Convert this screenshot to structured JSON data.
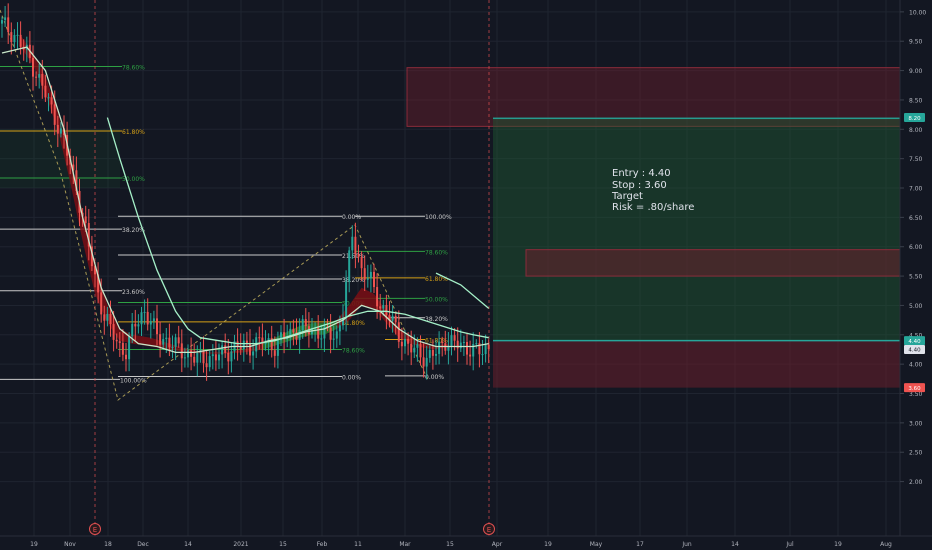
{
  "chart_data": {
    "type": "candlestick",
    "ylim": [
      1.55,
      10.1
    ],
    "x_ticks": [
      "19",
      "Nov",
      "18",
      "Dec",
      "14",
      "2021",
      "15",
      "Feb",
      "11",
      "Mar",
      "15",
      "Apr",
      "19",
      "May",
      "17",
      "Jun",
      "14",
      "Jul",
      "19",
      "Aug"
    ],
    "y_ticks": [
      "10.00",
      "9.50",
      "9.00",
      "8.50",
      "8.00",
      "7.50",
      "7.00",
      "6.50",
      "6.00",
      "5.50",
      "5.00",
      "4.50",
      "4.00",
      "3.50",
      "3.00",
      "2.50",
      "2.00"
    ],
    "y_tick_values": [
      10,
      9.5,
      9,
      8.5,
      8,
      7.5,
      7,
      6.5,
      6,
      5.5,
      5,
      4.5,
      4,
      3.5,
      3,
      2.5,
      2
    ],
    "price_path": [
      [
        0,
        9.8
      ],
      [
        4,
        9.6
      ],
      [
        8,
        9.3
      ],
      [
        14,
        8.6
      ],
      [
        20,
        7.8
      ],
      [
        24,
        7.0
      ],
      [
        28,
        6.0
      ],
      [
        31,
        5.2
      ],
      [
        33,
        4.8
      ],
      [
        36,
        4.5
      ],
      [
        38,
        4.3
      ],
      [
        40,
        4.2
      ],
      [
        43,
        4.7
      ],
      [
        46,
        4.9
      ],
      [
        50,
        4.5
      ],
      [
        56,
        4.3
      ],
      [
        62,
        4.1
      ],
      [
        68,
        4.1
      ],
      [
        72,
        4.2
      ],
      [
        76,
        4.3
      ],
      [
        80,
        4.3
      ],
      [
        84,
        4.4
      ],
      [
        88,
        4.3
      ],
      [
        92,
        4.5
      ],
      [
        96,
        4.6
      ],
      [
        100,
        4.6
      ],
      [
        104,
        4.5
      ],
      [
        108,
        4.5
      ],
      [
        110,
        4.9
      ],
      [
        113,
        6.2
      ],
      [
        116,
        5.6
      ],
      [
        119,
        5.4
      ],
      [
        122,
        5.0
      ],
      [
        125,
        4.8
      ],
      [
        128,
        4.5
      ],
      [
        131,
        4.3
      ],
      [
        134,
        4.2
      ],
      [
        137,
        4.1
      ],
      [
        140,
        4.2
      ],
      [
        143,
        4.4
      ],
      [
        146,
        4.35
      ],
      [
        149,
        4.3
      ],
      [
        152,
        4.25
      ],
      [
        155,
        4.2
      ],
      [
        157,
        4.3
      ]
    ],
    "moving_average": [
      [
        0,
        9.3
      ],
      [
        8,
        9.4
      ],
      [
        14,
        9.0
      ],
      [
        20,
        8.0
      ],
      [
        26,
        6.5
      ],
      [
        32,
        5.3
      ],
      [
        38,
        4.6
      ],
      [
        44,
        4.35
      ],
      [
        50,
        4.3
      ],
      [
        56,
        4.2
      ],
      [
        62,
        4.2
      ],
      [
        68,
        4.25
      ],
      [
        74,
        4.3
      ],
      [
        80,
        4.3
      ],
      [
        86,
        4.4
      ],
      [
        92,
        4.45
      ],
      [
        98,
        4.55
      ],
      [
        104,
        4.6
      ],
      [
        110,
        4.75
      ],
      [
        116,
        5.0
      ],
      [
        122,
        4.9
      ],
      [
        128,
        4.6
      ],
      [
        134,
        4.4
      ],
      [
        140,
        4.3
      ],
      [
        146,
        4.3
      ],
      [
        152,
        4.3
      ],
      [
        157,
        4.35
      ]
    ],
    "ribbon_upper": [
      [
        6,
        9.6
      ],
      [
        10,
        9.3
      ],
      [
        14,
        8.9
      ],
      [
        18,
        8.3
      ],
      [
        22,
        7.5
      ],
      [
        26,
        6.6
      ],
      [
        30,
        5.7
      ],
      [
        34,
        5.0
      ],
      [
        38,
        4.6
      ],
      [
        42,
        4.5
      ],
      [
        48,
        4.45
      ],
      [
        54,
        4.35
      ],
      [
        60,
        4.25
      ],
      [
        66,
        4.2
      ],
      [
        72,
        4.2
      ],
      [
        78,
        4.25
      ],
      [
        84,
        4.35
      ],
      [
        90,
        4.5
      ],
      [
        96,
        4.65
      ],
      [
        100,
        4.7
      ],
      [
        104,
        4.7
      ],
      [
        108,
        4.75
      ],
      [
        112,
        5.0
      ],
      [
        116,
        5.3
      ],
      [
        120,
        5.2
      ],
      [
        124,
        4.9
      ],
      [
        128,
        4.6
      ],
      [
        132,
        4.45
      ],
      [
        136,
        4.35
      ],
      [
        140,
        4.3
      ],
      [
        144,
        4.35
      ]
    ],
    "ribbon_lower": [
      [
        6,
        9.4
      ],
      [
        10,
        9.1
      ],
      [
        14,
        8.6
      ],
      [
        18,
        8.0
      ],
      [
        22,
        7.1
      ],
      [
        26,
        6.1
      ],
      [
        30,
        5.2
      ],
      [
        34,
        4.7
      ],
      [
        38,
        4.4
      ],
      [
        42,
        4.35
      ],
      [
        48,
        4.3
      ],
      [
        54,
        4.25
      ],
      [
        60,
        4.2
      ],
      [
        66,
        4.18
      ],
      [
        72,
        4.18
      ],
      [
        78,
        4.2
      ],
      [
        84,
        4.25
      ],
      [
        90,
        4.35
      ],
      [
        96,
        4.45
      ],
      [
        100,
        4.5
      ],
      [
        104,
        4.5
      ],
      [
        108,
        4.6
      ],
      [
        112,
        4.75
      ],
      [
        116,
        5.0
      ],
      [
        120,
        4.95
      ],
      [
        124,
        4.7
      ],
      [
        128,
        4.45
      ],
      [
        132,
        4.35
      ],
      [
        136,
        4.28
      ],
      [
        140,
        4.25
      ],
      [
        144,
        4.3
      ]
    ],
    "slow_ma": [
      [
        34,
        8.2
      ],
      [
        38,
        7.5
      ],
      [
        44,
        6.5
      ],
      [
        50,
        5.6
      ],
      [
        56,
        4.9
      ],
      [
        60,
        4.6
      ],
      [
        64,
        4.45
      ],
      [
        70,
        4.4
      ],
      [
        76,
        4.35
      ],
      [
        82,
        4.35
      ],
      [
        88,
        4.4
      ],
      [
        94,
        4.5
      ],
      [
        100,
        4.6
      ],
      [
        106,
        4.7
      ],
      [
        112,
        4.82
      ],
      [
        118,
        4.9
      ],
      [
        124,
        4.9
      ],
      [
        130,
        4.85
      ],
      [
        136,
        4.75
      ],
      [
        142,
        4.65
      ],
      [
        148,
        4.55
      ],
      [
        152,
        4.5
      ],
      [
        157,
        4.45
      ]
    ],
    "fib_levels": [
      {
        "label": "78.60%",
        "value": 9.07
      },
      {
        "label": "61.80%",
        "value": 7.97
      },
      {
        "label": "50.00%",
        "value": 7.17
      },
      {
        "label": "38.20%",
        "value": 6.3
      },
      {
        "label": "23.60%",
        "value": 5.25
      },
      {
        "label": "0.00%",
        "value": 6.52
      },
      {
        "label": "21.60%",
        "value": 5.86
      },
      {
        "label": "38.20%",
        "value": 5.45
      },
      {
        "label": "50.00%",
        "value": 5.05
      },
      {
        "label": "61.80%",
        "value": 4.72
      },
      {
        "label": "78.60%",
        "value": 4.25
      },
      {
        "label": "100.00%",
        "value": 3.74
      },
      {
        "label": "0.00%",
        "value": 3.79
      },
      {
        "label": "100.00%",
        "value": 6.52
      },
      {
        "label": "78.60%",
        "value": 5.92
      },
      {
        "label": "61.80%",
        "value": 5.47
      },
      {
        "label": "50.00%",
        "value": 5.12
      },
      {
        "label": "38.20%",
        "value": 4.79
      },
      {
        "label": "61.80%",
        "value": 4.42
      },
      {
        "label": "0.00%",
        "value": 3.8
      }
    ],
    "annotation_lines": [
      "Entry : 4.40",
      "Stop : 3.60",
      "Target",
      "Risk = .80/share"
    ],
    "price_labels": [
      {
        "text": "8.20",
        "value": 8.2,
        "color": "#26a69a"
      },
      {
        "text": "4.40",
        "value": 4.4,
        "color": "#26a69a"
      },
      {
        "text": "4.40",
        "value": 4.25,
        "color": "#e0e3eb"
      },
      {
        "text": "3.60",
        "value": 3.6,
        "color": "#ef5350"
      }
    ],
    "event_markers": [
      "E",
      "E"
    ],
    "grid": true
  },
  "colors": {
    "background": "#131722",
    "grid": "#1f2430",
    "axis_text": "#b2b5be",
    "up": "#26a69a",
    "down": "#ef5350",
    "ma": "#c8e6c9",
    "slow_ma": "#a5f0c8",
    "ribbon_down": "#7a0e14",
    "ribbon_up": "#1b7a2a",
    "fib_green": "#2ea043",
    "fib_yellow": "#d4a017",
    "fib_white": "#c9c9c9",
    "target_zone": "#1e5a34",
    "stop_zone": "#6a1f2c",
    "event": "#e05050"
  }
}
